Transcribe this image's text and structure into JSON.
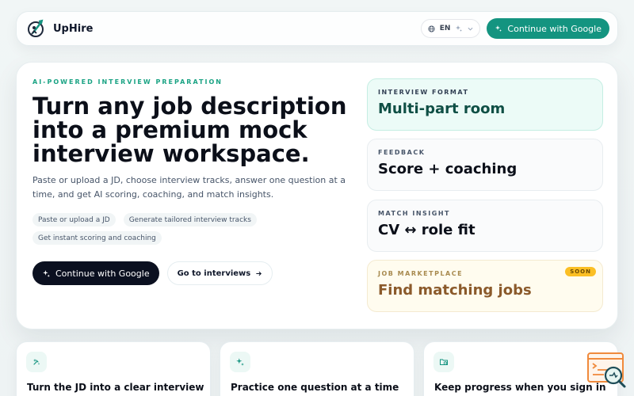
{
  "nav": {
    "brand": "UpHire",
    "language": "EN",
    "google_button": "Continue with Google"
  },
  "hero": {
    "eyebrow": "AI-POWERED INTERVIEW PREPARATION",
    "headline": "Turn any job description into a premium mock interview workspace.",
    "description": "Paste or upload a JD, choose interview tracks, answer one question at a time, and get AI scoring, coaching, and match insights.",
    "chips": [
      "Paste or upload a JD",
      "Generate tailored interview tracks",
      "Get instant scoring and coaching"
    ],
    "primary_cta": "Continue with Google",
    "secondary_cta": "Go to interviews"
  },
  "features": [
    {
      "label": "INTERVIEW FORMAT",
      "title": "Multi-part room"
    },
    {
      "label": "FEEDBACK",
      "title": "Score + coaching"
    },
    {
      "label": "MATCH INSIGHT",
      "title": "CV ↔ role fit"
    },
    {
      "label": "JOB MARKETPLACE",
      "title": "Find matching jobs",
      "badge": "SOON"
    }
  ],
  "bottom_cards": [
    {
      "title": "Turn the JD into a clear interview",
      "icon": "sparkle-pen-icon"
    },
    {
      "title": "Practice one question at a time",
      "icon": "sparkles-icon"
    },
    {
      "title": "Keep progress when you sign in",
      "icon": "folder-clock-icon"
    }
  ],
  "colors": {
    "accent": "#149480",
    "dark": "#0b1020",
    "soon_badge": "#fbbf24"
  }
}
